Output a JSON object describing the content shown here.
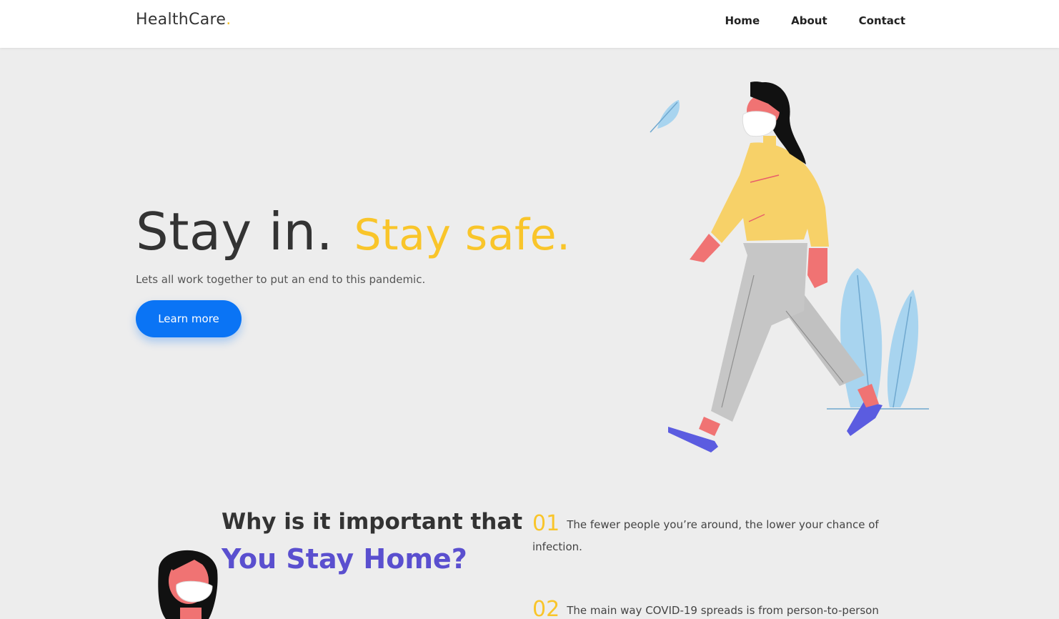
{
  "navbar": {
    "brand": "HealthCare",
    "brand_dot": ".",
    "links": [
      {
        "label": "Home"
      },
      {
        "label": "About"
      },
      {
        "label": "Contact"
      }
    ]
  },
  "hero": {
    "title_main": "Stay in.",
    "title_accent": "Stay safe.",
    "subtitle": "Lets all work together to put an end to this pandemic.",
    "cta_label": "Learn more"
  },
  "section_why": {
    "title_line1": "Why is it important that",
    "title_line2": "You Stay Home?",
    "reasons": [
      {
        "number": "01",
        "text": "The fewer people you’re around, the lower your chance of infection."
      },
      {
        "number": "02",
        "text": "The main way COVID-19 spreads is from person-to-person"
      }
    ]
  },
  "colors": {
    "accent_yellow": "#f9c52a",
    "cta_blue": "#0a74f5",
    "accent_purple": "#5a4fcf",
    "background": "#ededed"
  }
}
